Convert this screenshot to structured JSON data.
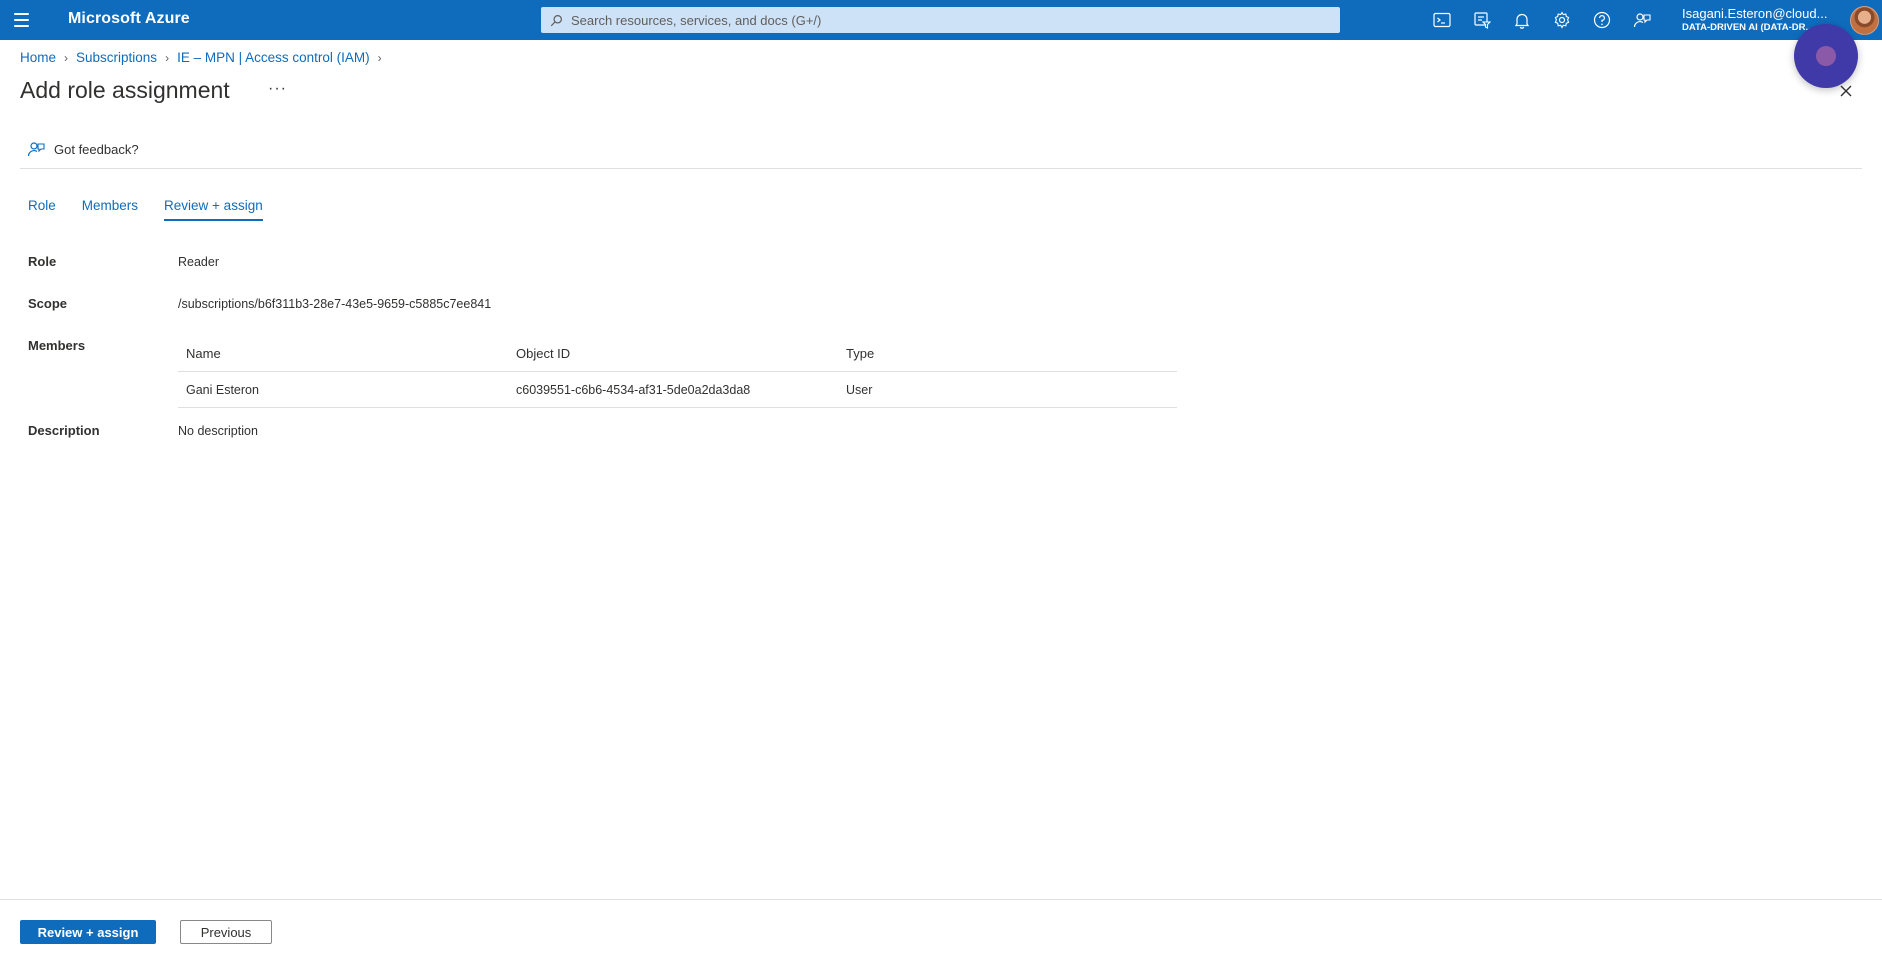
{
  "topbar": {
    "brand": "Microsoft Azure",
    "search_placeholder": "Search resources, services, and docs (G+/)",
    "icons": [
      "cloud-shell-icon",
      "directory-filter-icon",
      "notifications-icon",
      "settings-icon",
      "help-icon",
      "feedback-icon"
    ],
    "account": {
      "user": "Isagani.Esteron@cloud...",
      "tenant": "DATA-DRIVEN AI (DATA-DR..."
    },
    "accent_color": "#0f6cbd"
  },
  "breadcrumb": [
    "Home",
    "Subscriptions",
    "IE – MPN | Access control (IAM)"
  ],
  "page": {
    "title": "Add role assignment",
    "more": "···",
    "feedback": "Got feedback?"
  },
  "tabs": [
    {
      "label": "Role",
      "active": false
    },
    {
      "label": "Members",
      "active": false
    },
    {
      "label": "Review + assign",
      "active": true
    }
  ],
  "details": {
    "role_label": "Role",
    "role_value": "Reader",
    "scope_label": "Scope",
    "scope_value": "/subscriptions/b6f311b3-28e7-43e5-9659-c5885c7ee841",
    "members_label": "Members",
    "members_table": {
      "columns": [
        "Name",
        "Object ID",
        "Type"
      ],
      "rows": [
        {
          "name": "Gani Esteron",
          "object_id": "c6039551-c6b6-4534-af31-5de0a2da3da8",
          "type": "User"
        }
      ]
    },
    "description_label": "Description",
    "description_value": "No description"
  },
  "footer": {
    "primary_button": "Review + assign",
    "secondary_button": "Previous"
  }
}
